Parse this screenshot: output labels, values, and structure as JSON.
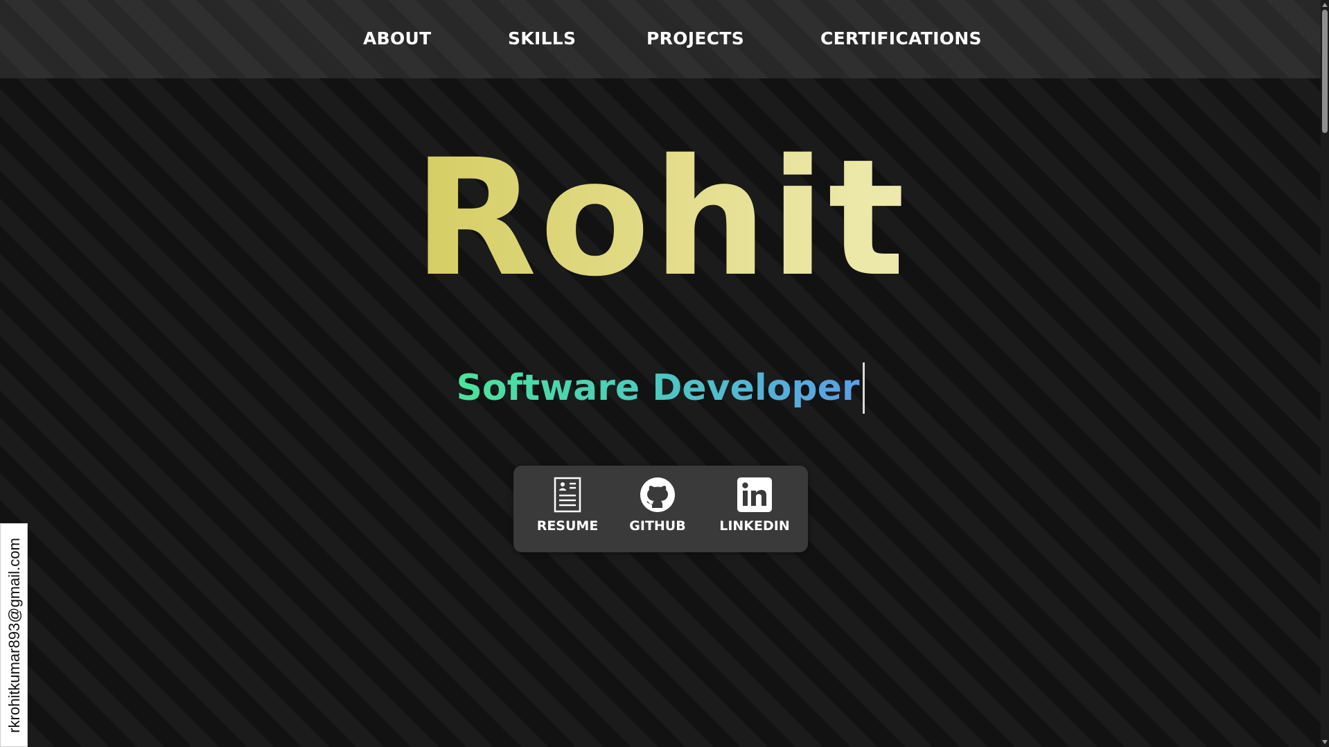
{
  "nav": {
    "items": [
      {
        "label": "ABOUT"
      },
      {
        "label": "SKILLS"
      },
      {
        "label": "PROJECTS"
      },
      {
        "label": "CERTIFICATIONS"
      }
    ]
  },
  "hero": {
    "name": "Rohit",
    "subtitle": "Software Developer"
  },
  "social": {
    "links": [
      {
        "label": "RESUME",
        "icon": "resume-icon"
      },
      {
        "label": "GITHUB",
        "icon": "github-icon"
      },
      {
        "label": "LINKEDIN",
        "icon": "linkedin-icon"
      }
    ]
  },
  "contact": {
    "email": "rkrohitkumar893@gmail.com"
  },
  "colors": {
    "name_gradient": [
      "#b3a81f",
      "#f8f6d6"
    ],
    "subtitle_gradient": [
      "#4be39a",
      "#5b9ee8"
    ],
    "card_background": "#3a3a3a"
  }
}
